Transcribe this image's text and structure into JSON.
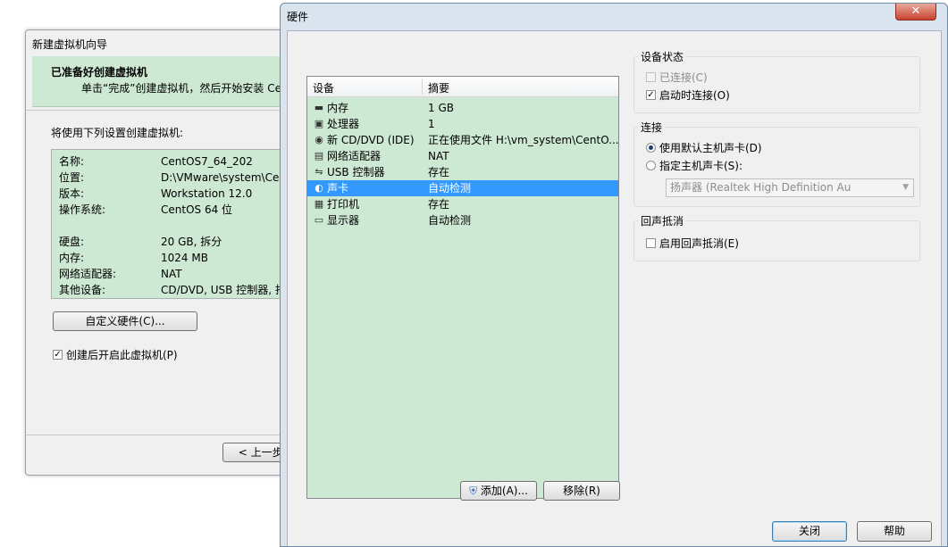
{
  "wizard": {
    "title": "新建虚拟机向导",
    "header_title": "已准备好创建虚拟机",
    "header_sub": "单击“完成”创建虚拟机，然后开始安装 Cent",
    "intro": "将使用下列设置创建虚拟机:",
    "summary": [
      {
        "key": "名称:",
        "value": "CentOS7_64_202"
      },
      {
        "key": "位置:",
        "value": "D:\\VMware\\system\\Cent"
      },
      {
        "key": "版本:",
        "value": "Workstation 12.0"
      },
      {
        "key": "操作系统:",
        "value": "CentOS 64 位"
      },
      {
        "key": "硬盘:",
        "value": "20 GB, 拆分"
      },
      {
        "key": "内存:",
        "value": "1024 MB"
      },
      {
        "key": "网络适配器:",
        "value": "NAT"
      },
      {
        "key": "其他设备:",
        "value": "CD/DVD, USB 控制器, 打"
      }
    ],
    "custom_hw_button": "自定义硬件(C)...",
    "start_after_create": "创建后开启此虚拟机(P)",
    "prev_button": "< 上一步("
  },
  "hardware": {
    "title": "硬件",
    "close_glyph": "✕",
    "columns": {
      "device": "设备",
      "summary": "摘要"
    },
    "devices": [
      {
        "icon": "memory-icon",
        "glyph": "▬",
        "name": "内存",
        "summary": "1 GB",
        "selected": false
      },
      {
        "icon": "cpu-icon",
        "glyph": "▣",
        "name": "处理器",
        "summary": "1",
        "selected": false
      },
      {
        "icon": "cd-dvd-icon",
        "glyph": "◉",
        "name": "新 CD/DVD (IDE)",
        "summary": "正在使用文件 H:\\vm_system\\CentO...",
        "selected": false
      },
      {
        "icon": "network-adapter-icon",
        "glyph": "▤",
        "name": "网络适配器",
        "summary": "NAT",
        "selected": false
      },
      {
        "icon": "usb-icon",
        "glyph": "⇋",
        "name": "USB 控制器",
        "summary": "存在",
        "selected": false
      },
      {
        "icon": "sound-card-icon",
        "glyph": "◐",
        "name": "声卡",
        "summary": "自动检测",
        "selected": true
      },
      {
        "icon": "printer-icon",
        "glyph": "▦",
        "name": "打印机",
        "summary": "存在",
        "selected": false
      },
      {
        "icon": "display-icon",
        "glyph": "▭",
        "name": "显示器",
        "summary": "自动检测",
        "selected": false
      }
    ],
    "add_button": "添加(A)...",
    "remove_button": "移除(R)",
    "device_status": {
      "label": "设备状态",
      "connected": "已连接(C)",
      "connect_on_power": "启动时连接(O)"
    },
    "connection": {
      "label": "连接",
      "use_default": "使用默认主机声卡(D)",
      "specify": "指定主机声卡(S):",
      "device_value": "扬声器 (Realtek High Definition Au"
    },
    "echo": {
      "label": "回声抵消",
      "enable": "启用回声抵消(E)"
    },
    "close_button": "关闭",
    "help_button": "帮助"
  }
}
